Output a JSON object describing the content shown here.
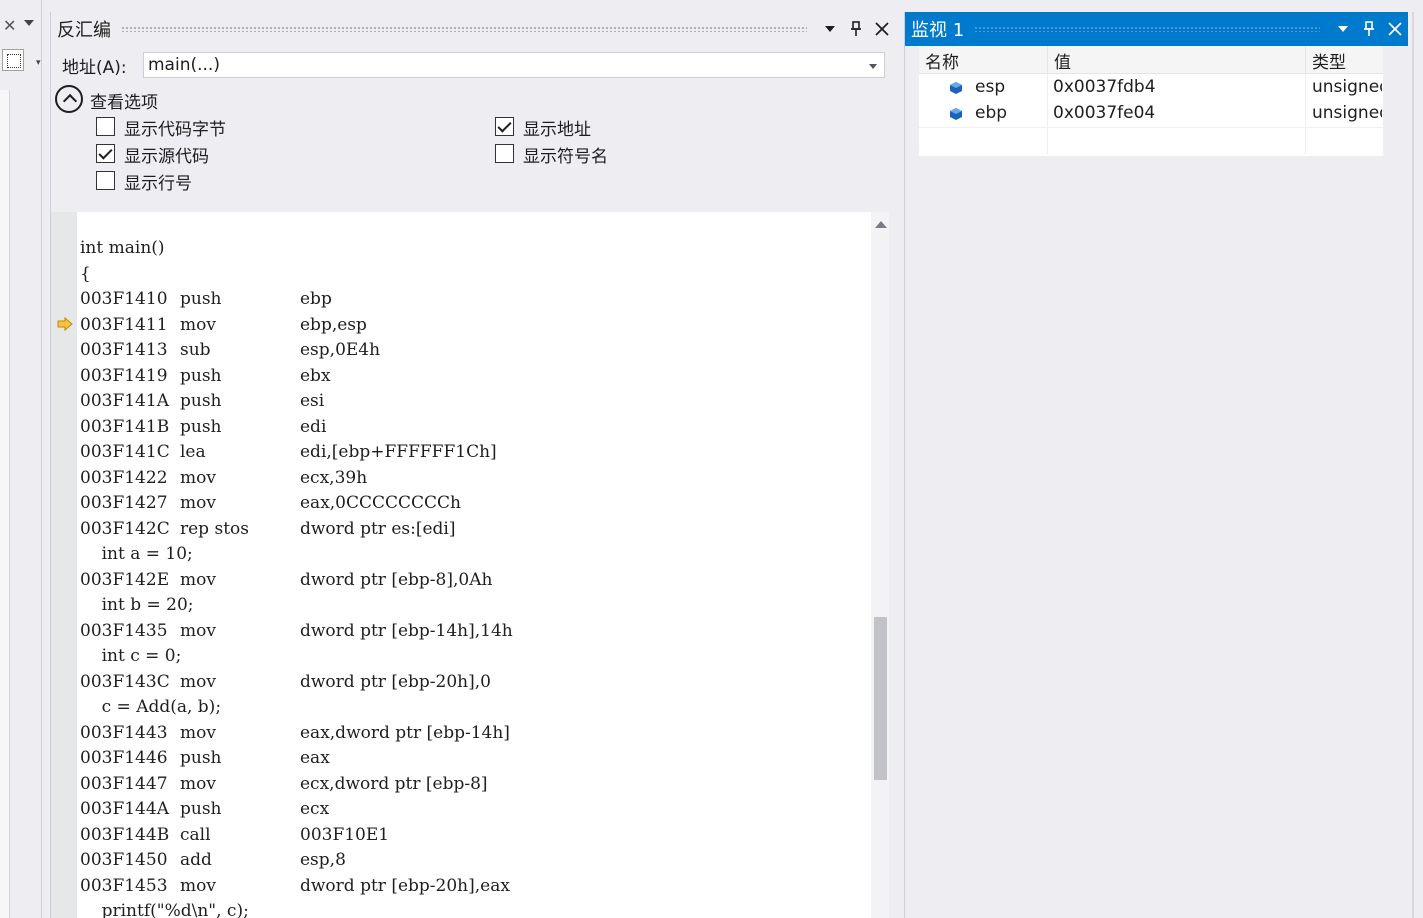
{
  "left_strip": {
    "close_glyph": "✕"
  },
  "disasm": {
    "title": "反汇编",
    "address_label": "地址(A):",
    "address_value": "main(...)",
    "options_title": "查看选项",
    "options": [
      {
        "label": "显示代码字节",
        "checked": false
      },
      {
        "label": "显示地址",
        "checked": true
      },
      {
        "label": "显示源代码",
        "checked": true
      },
      {
        "label": "显示符号名",
        "checked": false
      },
      {
        "label": "显示行号",
        "checked": false
      }
    ],
    "current_line_index": 3,
    "lines": [
      {
        "kind": "src",
        "text": "int main()"
      },
      {
        "kind": "src",
        "text": "{"
      },
      {
        "kind": "asm",
        "addr": "003F1410",
        "op": "push",
        "arg": "ebp"
      },
      {
        "kind": "asm",
        "addr": "003F1411",
        "op": "mov",
        "arg": "ebp,esp"
      },
      {
        "kind": "asm",
        "addr": "003F1413",
        "op": "sub",
        "arg": "esp,0E4h"
      },
      {
        "kind": "asm",
        "addr": "003F1419",
        "op": "push",
        "arg": "ebx"
      },
      {
        "kind": "asm",
        "addr": "003F141A",
        "op": "push",
        "arg": "esi"
      },
      {
        "kind": "asm",
        "addr": "003F141B",
        "op": "push",
        "arg": "edi"
      },
      {
        "kind": "asm",
        "addr": "003F141C",
        "op": "lea",
        "arg": "edi,[ebp+FFFFFF1Ch]"
      },
      {
        "kind": "asm",
        "addr": "003F1422",
        "op": "mov",
        "arg": "ecx,39h"
      },
      {
        "kind": "asm",
        "addr": "003F1427",
        "op": "mov",
        "arg": "eax,0CCCCCCCCh"
      },
      {
        "kind": "asm",
        "addr": "003F142C",
        "op": "rep stos",
        "arg": "dword ptr es:[edi]"
      },
      {
        "kind": "src",
        "text": "    int a = 10;"
      },
      {
        "kind": "asm",
        "addr": "003F142E",
        "op": "mov",
        "arg": "dword ptr [ebp-8],0Ah"
      },
      {
        "kind": "src",
        "text": "    int b = 20;"
      },
      {
        "kind": "asm",
        "addr": "003F1435",
        "op": "mov",
        "arg": "dword ptr [ebp-14h],14h"
      },
      {
        "kind": "src",
        "text": "    int c = 0;"
      },
      {
        "kind": "asm",
        "addr": "003F143C",
        "op": "mov",
        "arg": "dword ptr [ebp-20h],0"
      },
      {
        "kind": "src",
        "text": "    c = Add(a, b);"
      },
      {
        "kind": "asm",
        "addr": "003F1443",
        "op": "mov",
        "arg": "eax,dword ptr [ebp-14h]"
      },
      {
        "kind": "asm",
        "addr": "003F1446",
        "op": "push",
        "arg": "eax"
      },
      {
        "kind": "asm",
        "addr": "003F1447",
        "op": "mov",
        "arg": "ecx,dword ptr [ebp-8]"
      },
      {
        "kind": "asm",
        "addr": "003F144A",
        "op": "push",
        "arg": "ecx"
      },
      {
        "kind": "asm",
        "addr": "003F144B",
        "op": "call",
        "arg": "003F10E1"
      },
      {
        "kind": "asm",
        "addr": "003F1450",
        "op": "add",
        "arg": "esp,8"
      },
      {
        "kind": "asm",
        "addr": "003F1453",
        "op": "mov",
        "arg": "dword ptr [ebp-20h],eax"
      },
      {
        "kind": "src",
        "text": "    printf(\"%d\\n\", c);"
      }
    ]
  },
  "watch": {
    "title": "监视 1",
    "columns": [
      "名称",
      "值",
      "类型"
    ],
    "rows": [
      {
        "name": "esp",
        "value": "0x0037fdb4",
        "type": "unsigned"
      },
      {
        "name": "ebp",
        "value": "0x0037fe04",
        "type": "unsigned"
      }
    ]
  },
  "colors": {
    "accent": "#007acc",
    "current_arrow": "#f5c242",
    "panel_bg": "#eeeef2",
    "variable_icon": "#1c63b7"
  }
}
